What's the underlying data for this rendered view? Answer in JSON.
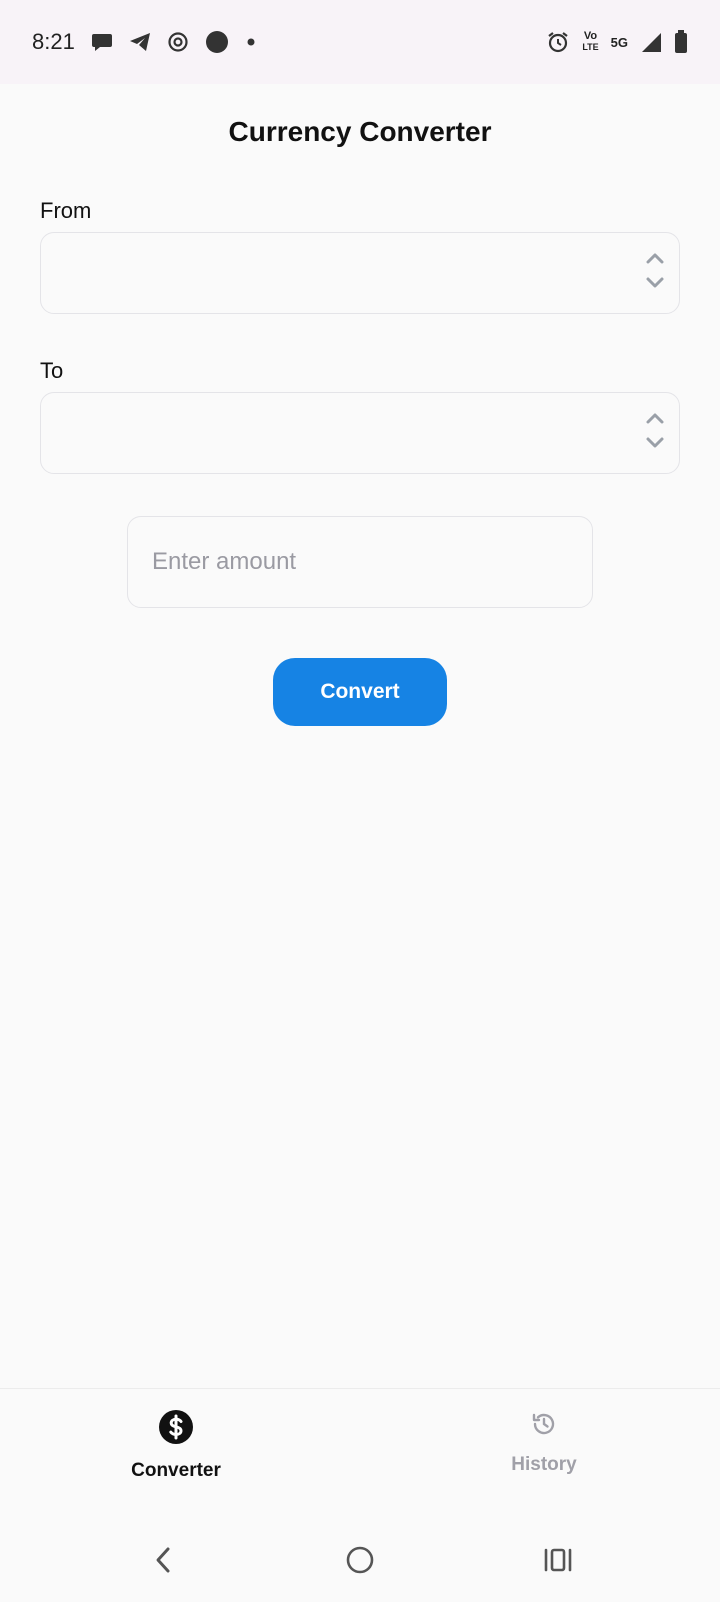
{
  "status_bar": {
    "time": "8:21",
    "left_icons": [
      "chat-bubble-icon",
      "telegram-icon",
      "location-ring-icon",
      "dot-filled-icon",
      "small-dot-icon"
    ],
    "network_label_top": "Vo",
    "network_label_bottom": "LTE",
    "network_type": "5G",
    "right_icons": [
      "alarm-icon",
      "volte-icon",
      "signal-icon",
      "battery-icon"
    ]
  },
  "header": {
    "title": "Currency Converter"
  },
  "form": {
    "from_label": "From",
    "from_value": "",
    "to_label": "To",
    "to_value": "",
    "amount_value": "",
    "amount_placeholder": "Enter amount",
    "convert_label": "Convert"
  },
  "tabs": [
    {
      "label": "Converter",
      "icon": "dollar-circle-icon",
      "active": true
    },
    {
      "label": "History",
      "icon": "history-icon",
      "active": false
    }
  ],
  "colors": {
    "accent": "#1683e4",
    "inactive_tab": "#a0a0a8",
    "background": "#fafafa",
    "status_bar": "#f8f3f8"
  }
}
